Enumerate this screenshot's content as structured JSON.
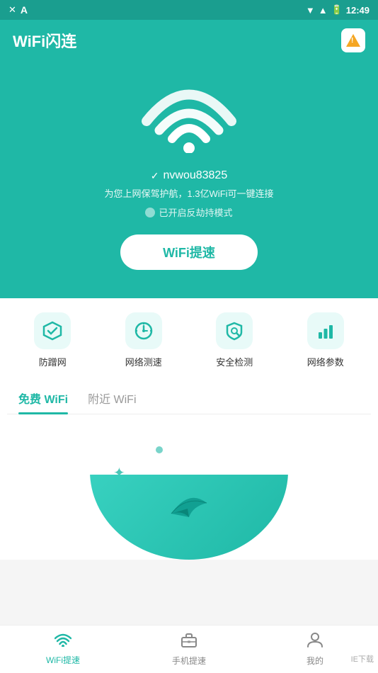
{
  "statusBar": {
    "time": "12:49",
    "icons": [
      "x-icon",
      "a-icon",
      "wifi-signal-icon",
      "signal-icon",
      "battery-icon"
    ]
  },
  "header": {
    "title": "WiFi闪连",
    "alertLabel": "alert"
  },
  "hero": {
    "connectedNetwork": "nvwou83825",
    "description": "为您上网保驾护航，1.3亿WiFi可一键连接",
    "modeLabel": "已开启反劫持模式",
    "speedButtonLabel": "WiFi提速"
  },
  "tools": [
    {
      "id": "anti-rub",
      "label": "防蹭网",
      "icon": "diamond"
    },
    {
      "id": "speed-test",
      "label": "网络测速",
      "icon": "speed"
    },
    {
      "id": "security-check",
      "label": "安全检测",
      "icon": "shield-search"
    },
    {
      "id": "network-params",
      "label": "网络参数",
      "icon": "bar-chart"
    }
  ],
  "tabs": [
    {
      "id": "free-wifi",
      "label": "免费 WiFi",
      "active": true
    },
    {
      "id": "nearby-wifi",
      "label": "附近 WiFi",
      "active": false
    }
  ],
  "bottomNav": [
    {
      "id": "wifi-speed",
      "label": "WiFi提速",
      "icon": "wifi",
      "active": true
    },
    {
      "id": "phone-speed",
      "label": "手机提速",
      "icon": "briefcase",
      "active": false
    },
    {
      "id": "mine",
      "label": "我的",
      "icon": "person",
      "active": false
    }
  ],
  "watermark": "IE下载"
}
